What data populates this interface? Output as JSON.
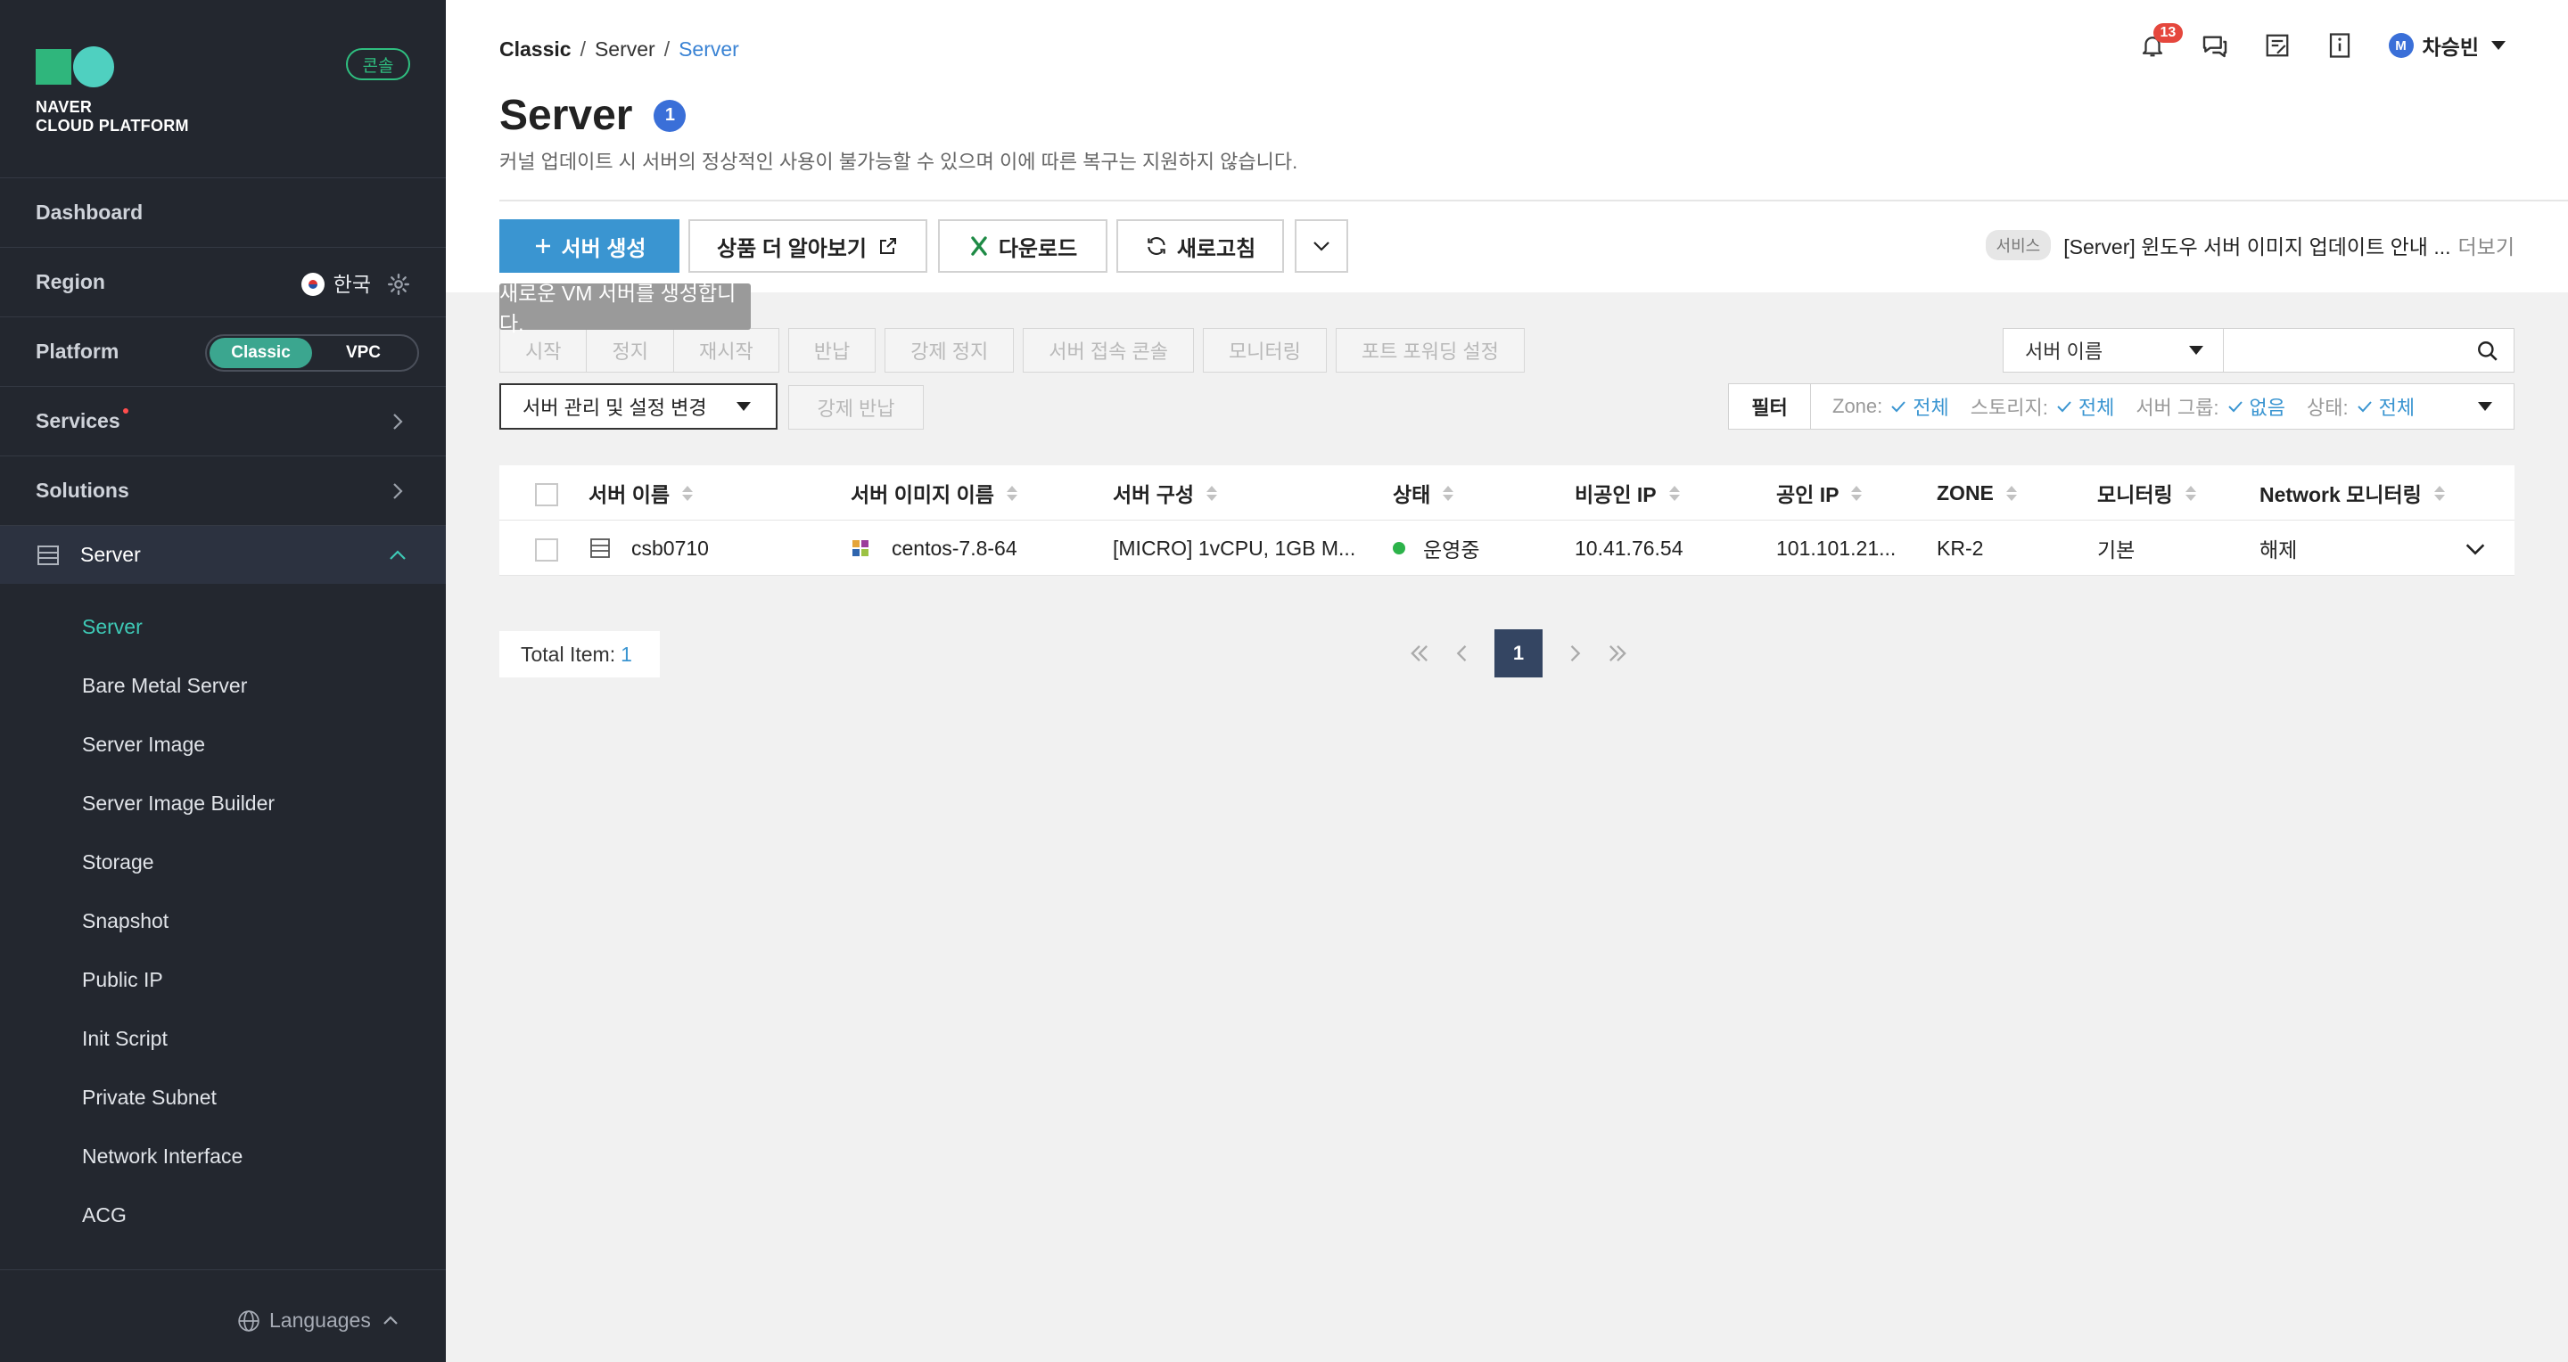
{
  "sidebar": {
    "logo_line1": "NAVER",
    "logo_line2": "CLOUD PLATFORM",
    "console_badge": "콘솔",
    "dashboard": "Dashboard",
    "region_label": "Region",
    "region_value": "한국",
    "platform_label": "Platform",
    "platform_options": [
      "Classic",
      "VPC"
    ],
    "platform_selected": "Classic",
    "services": "Services",
    "solutions": "Solutions",
    "server": "Server",
    "sub_items": [
      "Server",
      "Bare Metal Server",
      "Server Image",
      "Server Image Builder",
      "Storage",
      "Snapshot",
      "Public IP",
      "Init Script",
      "Private Subnet",
      "Network Interface",
      "ACG"
    ],
    "active_sub_item": "Server",
    "languages": "Languages"
  },
  "header": {
    "breadcrumb": [
      "Classic",
      "Server",
      "Server"
    ],
    "notification_count": "13",
    "user_initial": "M",
    "user_name": "차승빈"
  },
  "page": {
    "title": "Server",
    "count": "1",
    "notice": "커널 업데이트 시 서버의 정상적인 사용이 불가능할 수 있으며 이에 따른 복구는 지원하지 않습니다."
  },
  "toolbar": {
    "create": "서버 생성",
    "learn_more": "상품 더 알아보기",
    "download": "다운로드",
    "refresh": "새로고침",
    "tooltip": "새로운 VM 서버를 생성합니다."
  },
  "announcement": {
    "tag": "서비스",
    "text": "[Server] 윈도우 서버 이미지 업데이트 안내 ...",
    "more": "더보기"
  },
  "actions": [
    "시작",
    "정지",
    "재시작",
    "반납",
    "강제 정지",
    "서버 접속 콘솔",
    "모니터링",
    "포트 포워딩 설정"
  ],
  "manage": {
    "label": "서버 관리 및 설정 변경",
    "force_return": "강제 반납"
  },
  "search": {
    "field": "서버 이름",
    "placeholder": ""
  },
  "filter": {
    "label": "필터",
    "items": [
      {
        "key": "Zone:",
        "value": "전체"
      },
      {
        "key": "스토리지:",
        "value": "전체"
      },
      {
        "key": "서버 그룹:",
        "value": "없음"
      },
      {
        "key": "상태:",
        "value": "전체"
      }
    ]
  },
  "table": {
    "columns": [
      "서버 이름",
      "서버 이미지 이름",
      "서버 구성",
      "상태",
      "비공인 IP",
      "공인 IP",
      "ZONE",
      "모니터링",
      "Network 모니터링"
    ],
    "rows": [
      {
        "name": "csb0710",
        "image": "centos-7.8-64",
        "spec": "[MICRO] 1vCPU, 1GB M...",
        "status": "운영중",
        "private_ip": "10.41.76.54",
        "public_ip": "101.101.21...",
        "zone": "KR-2",
        "monitoring": "기본",
        "network_monitoring": "해제"
      }
    ]
  },
  "footer": {
    "total_label": "Total Item:",
    "total_value": "1",
    "current_page": "1"
  },
  "colors": {
    "sidebar_bg": "#23272f",
    "primary": "#3a95d1",
    "accent_green": "#2fbf80",
    "link_blue": "#3a83d4",
    "status_green": "#2cb34a",
    "badge_red": "#e5473d"
  }
}
